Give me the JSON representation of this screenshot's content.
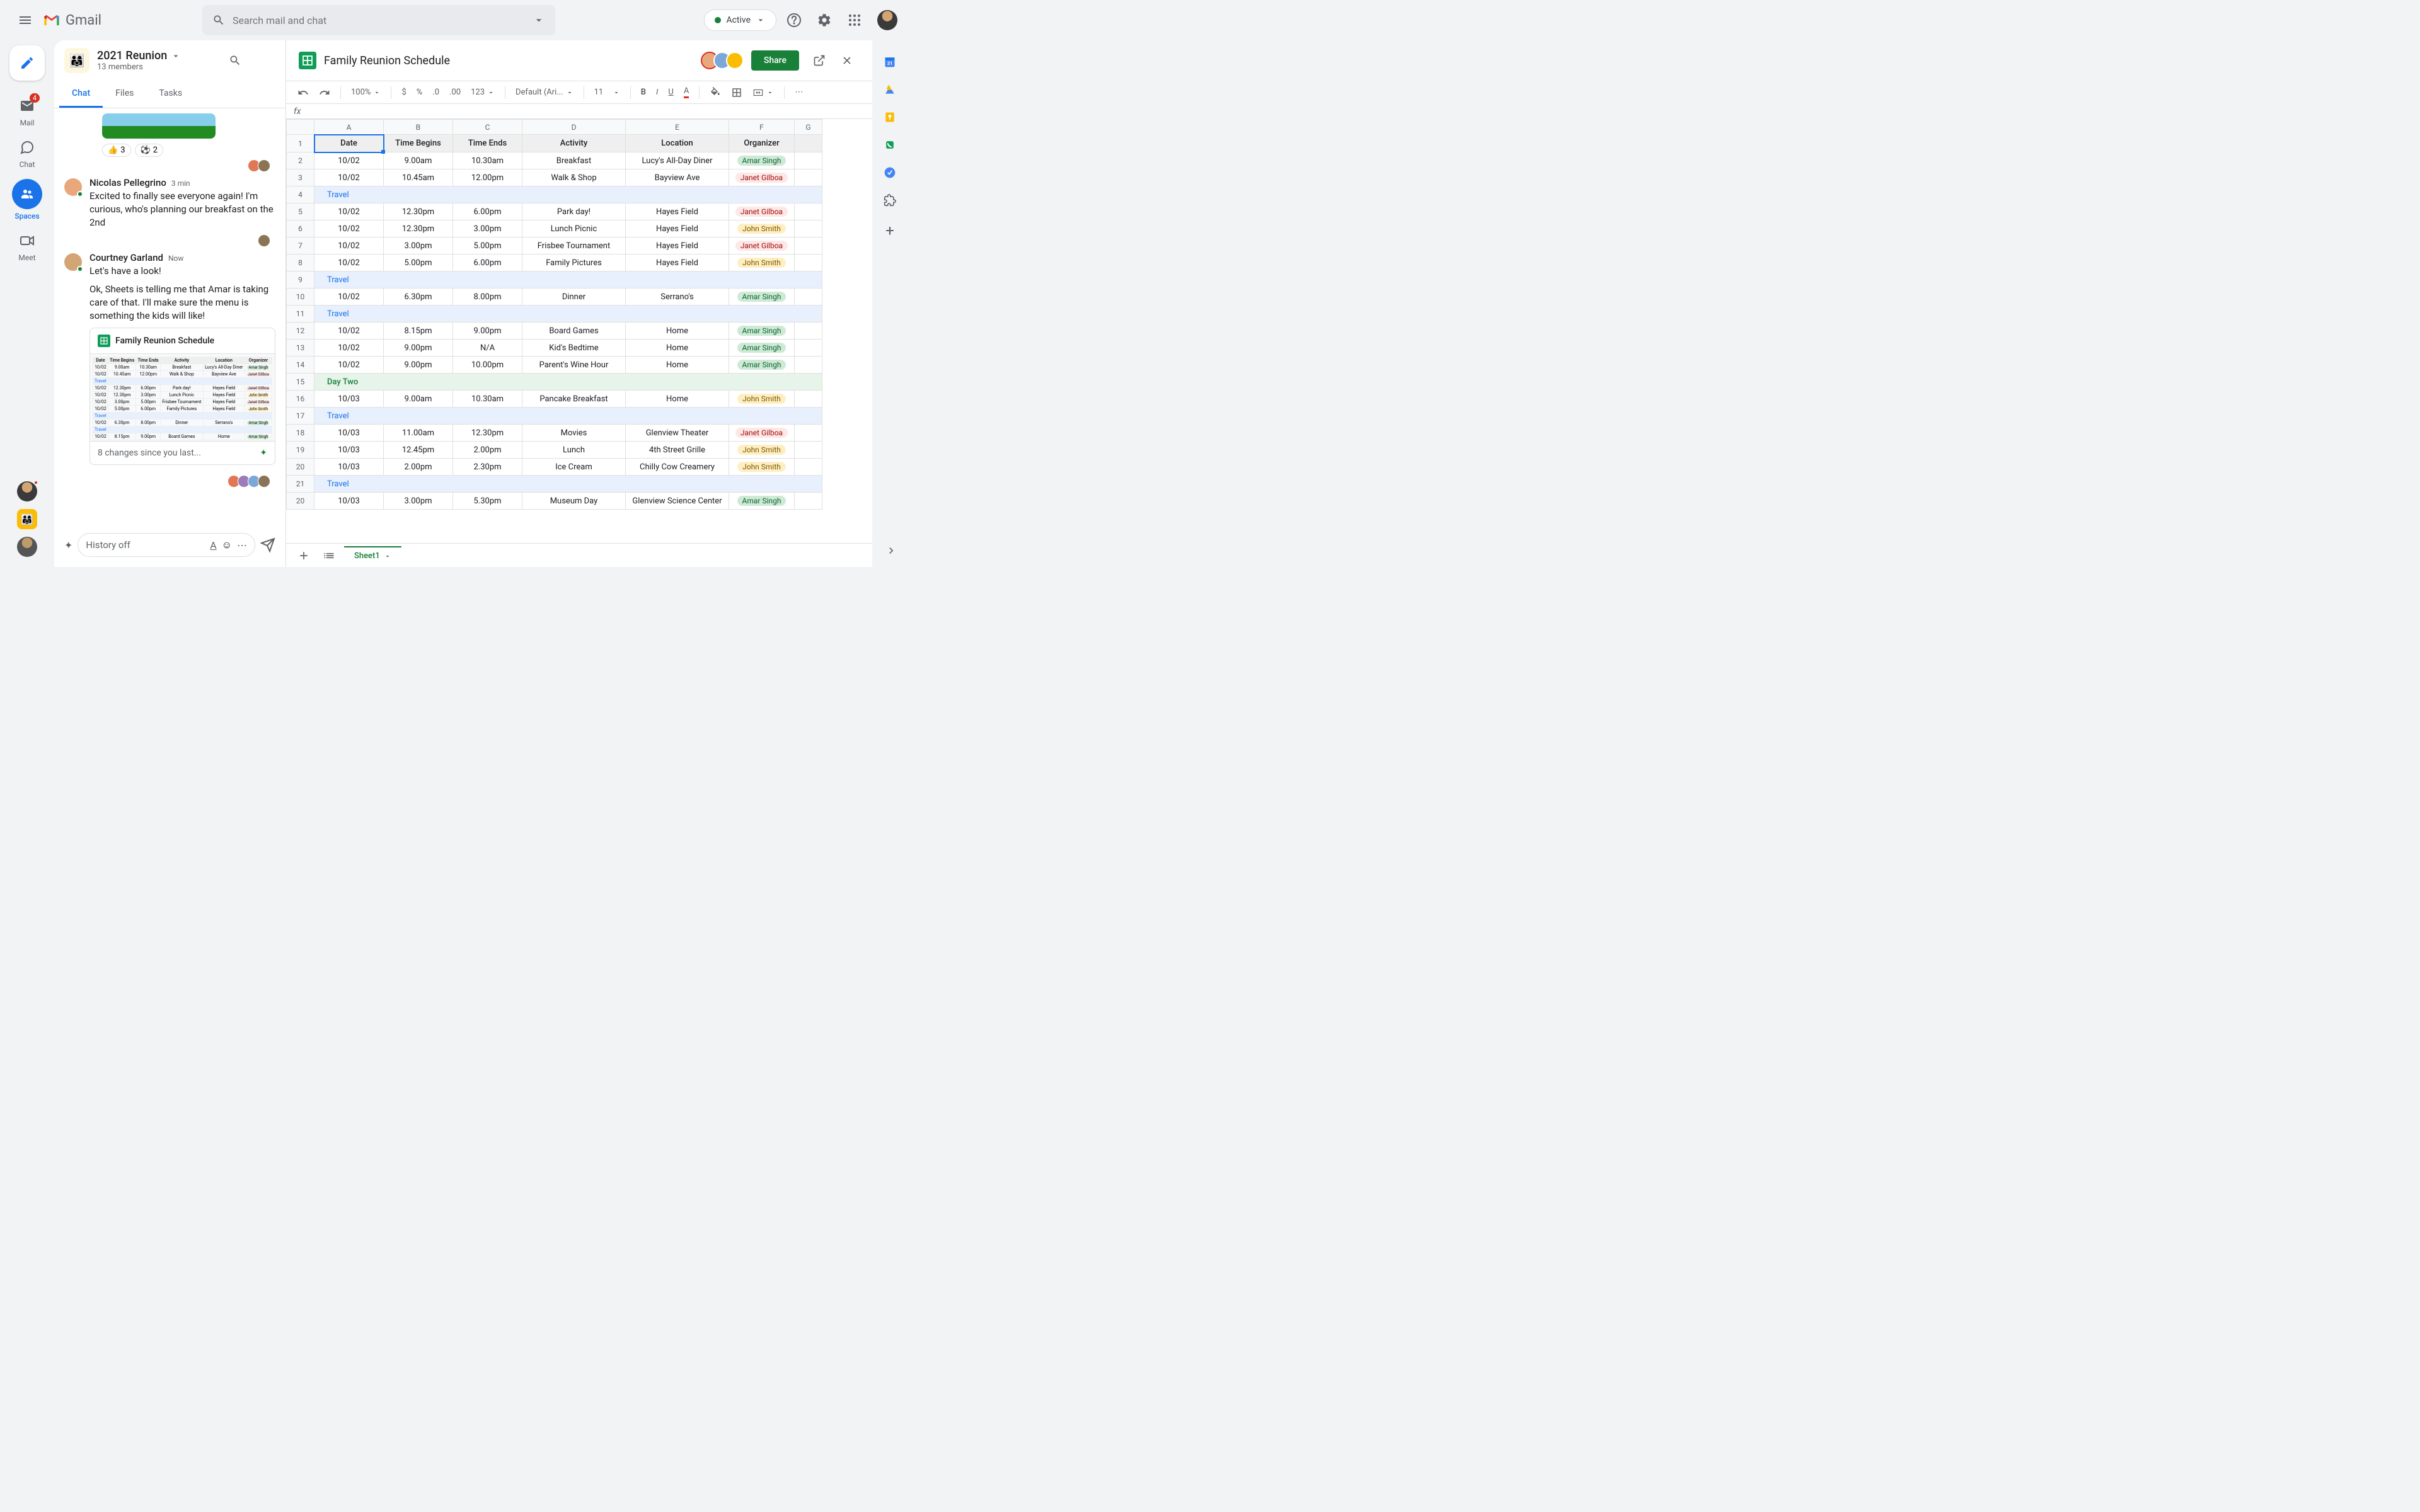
{
  "app": {
    "name": "Gmail"
  },
  "search": {
    "placeholder": "Search mail and chat"
  },
  "status": {
    "label": "Active"
  },
  "left_rail": {
    "items": [
      {
        "label": "Mail",
        "badge": "4"
      },
      {
        "label": "Chat"
      },
      {
        "label": "Spaces"
      },
      {
        "label": "Meet"
      }
    ]
  },
  "space": {
    "title": "2021 Reunion",
    "members": "13 members",
    "tabs": [
      "Chat",
      "Files",
      "Tasks"
    ],
    "reactions": [
      {
        "emoji": "👍",
        "count": "3"
      },
      {
        "emoji": "⚽",
        "count": "2"
      }
    ],
    "messages": [
      {
        "author": "Nicolas Pellegrino",
        "time": "3 min",
        "text": "Excited to finally see everyone again! I'm curious, who's planning our breakfast on the 2nd"
      },
      {
        "author": "Courtney Garland",
        "time": "Now",
        "text1": "Let's have a look!",
        "text2": "Ok, Sheets is telling me that Amar is taking care of that. I'll make sure the menu is something the kids will like!"
      }
    ],
    "sheet_card": {
      "title": "Family Reunion Schedule",
      "footer": "8 changes since you last..."
    },
    "input_placeholder": "History off"
  },
  "sheet": {
    "title": "Family Reunion Schedule",
    "share_label": "Share",
    "toolbar": {
      "zoom": "100%",
      "num_format": "123",
      "font": "Default (Ari...",
      "font_size": "11"
    },
    "tab_name": "Sheet1",
    "columns": [
      "A",
      "B",
      "C",
      "D",
      "E",
      "F",
      "G"
    ],
    "headers": [
      "Date",
      "Time Begins",
      "Time Ends",
      "Activity",
      "Location",
      "Organizer"
    ],
    "rows": [
      {
        "n": 2,
        "date": "10/02",
        "begin": "9.00am",
        "end": "10.30am",
        "activity": "Breakfast",
        "location": "Lucy's All-Day Diner",
        "organizer": "Amar Singh",
        "pill": "amar"
      },
      {
        "n": 3,
        "date": "10/02",
        "begin": "10.45am",
        "end": "12.00pm",
        "activity": "Walk & Shop",
        "location": "Bayview Ave",
        "organizer": "Janet Gilboa",
        "pill": "janet"
      },
      {
        "n": 4,
        "type": "travel",
        "label": "Travel"
      },
      {
        "n": 5,
        "date": "10/02",
        "begin": "12.30pm",
        "end": "6.00pm",
        "activity": "Park day!",
        "location": "Hayes Field",
        "organizer": "Janet Gilboa",
        "pill": "janet"
      },
      {
        "n": 6,
        "date": "10/02",
        "begin": "12.30pm",
        "end": "3.00pm",
        "activity": "Lunch Picnic",
        "location": "Hayes Field",
        "organizer": "John Smith",
        "pill": "john"
      },
      {
        "n": 7,
        "date": "10/02",
        "begin": "3.00pm",
        "end": "5.00pm",
        "activity": "Frisbee Tournament",
        "location": "Hayes Field",
        "organizer": "Janet Gilboa",
        "pill": "janet"
      },
      {
        "n": 8,
        "date": "10/02",
        "begin": "5.00pm",
        "end": "6.00pm",
        "activity": "Family Pictures",
        "location": "Hayes Field",
        "organizer": "John Smith",
        "pill": "john"
      },
      {
        "n": 9,
        "type": "travel",
        "label": "Travel"
      },
      {
        "n": 10,
        "date": "10/02",
        "begin": "6.30pm",
        "end": "8.00pm",
        "activity": "Dinner",
        "location": "Serrano's",
        "organizer": "Amar Singh",
        "pill": "amar"
      },
      {
        "n": 11,
        "type": "travel",
        "label": "Travel"
      },
      {
        "n": 12,
        "date": "10/02",
        "begin": "8.15pm",
        "end": "9.00pm",
        "activity": "Board Games",
        "location": "Home",
        "organizer": "Amar Singh",
        "pill": "amar"
      },
      {
        "n": 13,
        "date": "10/02",
        "begin": "9.00pm",
        "end": "N/A",
        "activity": "Kid's Bedtime",
        "location": "Home",
        "organizer": "Amar Singh",
        "pill": "amar"
      },
      {
        "n": 14,
        "date": "10/02",
        "begin": "9.00pm",
        "end": "10.00pm",
        "activity": "Parent's Wine Hour",
        "location": "Home",
        "organizer": "Amar Singh",
        "pill": "amar"
      },
      {
        "n": 15,
        "type": "daytwo",
        "label": "Day Two"
      },
      {
        "n": 16,
        "date": "10/03",
        "begin": "9.00am",
        "end": "10.30am",
        "activity": "Pancake Breakfast",
        "location": "Home",
        "organizer": "John Smith",
        "pill": "john"
      },
      {
        "n": 17,
        "type": "travel",
        "label": "Travel"
      },
      {
        "n": 18,
        "date": "10/03",
        "begin": "11.00am",
        "end": "12.30pm",
        "activity": "Movies",
        "location": "Glenview Theater",
        "organizer": "Janet Gilboa",
        "pill": "janet"
      },
      {
        "n": 19,
        "date": "10/03",
        "begin": "12.45pm",
        "end": "2.00pm",
        "activity": "Lunch",
        "location": "4th Street Grille",
        "organizer": "John Smith",
        "pill": "john"
      },
      {
        "n": 20,
        "date": "10/03",
        "begin": "2.00pm",
        "end": "2.30pm",
        "activity": "Ice Cream",
        "location": "Chilly Cow Creamery",
        "organizer": "John Smith",
        "pill": "john"
      },
      {
        "n": 21,
        "type": "travel",
        "label": "Travel"
      },
      {
        "n": 20,
        "date": "10/03",
        "begin": "3.00pm",
        "end": "5.30pm",
        "activity": "Museum Day",
        "location": "Glenview Science Center",
        "organizer": "Amar Singh",
        "pill": "amar"
      }
    ]
  },
  "right_rail": {
    "calendar_day": "31"
  }
}
